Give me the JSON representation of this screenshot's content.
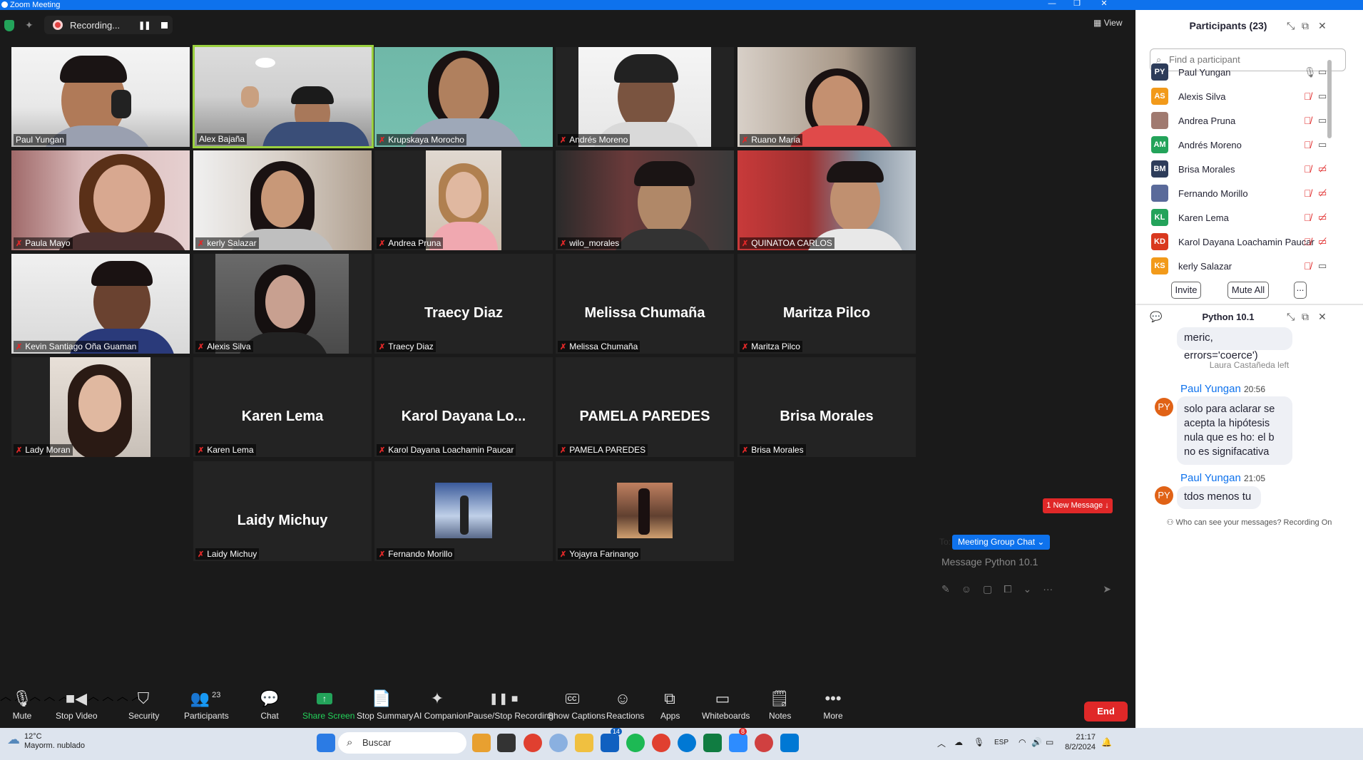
{
  "window": {
    "title": "Zoom Meeting"
  },
  "recording": {
    "label": "Recording..."
  },
  "view": {
    "label": "View"
  },
  "tiles": [
    {
      "name": "Paul Yungan"
    },
    {
      "name": "Alex Bajaña"
    },
    {
      "name": "Krupskaya Morocho"
    },
    {
      "name": "Andrés Moreno"
    },
    {
      "name": "Ruano Maria"
    },
    {
      "name": "Paula Mayo"
    },
    {
      "name": "kerly Salazar"
    },
    {
      "name": "Andrea Pruna"
    },
    {
      "name": "wilo_morales"
    },
    {
      "name": "QUINATOA CARLOS"
    },
    {
      "name": "Kevin Santiago Oña Guaman"
    },
    {
      "name": "Alexis Silva"
    },
    {
      "name": "Traecy Diaz",
      "big": "Traecy Diaz"
    },
    {
      "name": "Melissa Chumaña",
      "big": "Melissa Chumaña"
    },
    {
      "name": "Maritza Pilco",
      "big": "Maritza Pilco"
    },
    {
      "name": "Lady Moran"
    },
    {
      "name": "Karen Lema",
      "big": "Karen Lema"
    },
    {
      "name": "Karol Dayana Loachamin Paucar",
      "big": "Karol  Dayana  Lo..."
    },
    {
      "name": "PAMELA PAREDES",
      "big": "PAMELA PAREDES"
    },
    {
      "name": "Brisa Morales",
      "big": "Brisa Morales"
    },
    {
      "name": "Laidy Michuy",
      "big": "Laidy Michuy"
    },
    {
      "name": "Fernando Morillo"
    },
    {
      "name": "Yojayra Farinango"
    }
  ],
  "toolbar": {
    "mute": "Mute",
    "stop_video": "Stop Video",
    "security": "Security",
    "participants": "Participants",
    "participants_count": "23",
    "chat": "Chat",
    "share_screen": "Share Screen",
    "stop_summary": "Stop Summary",
    "ai_companion": "AI Companion",
    "pause_stop_recording": "Pause/Stop Recording",
    "show_captions": "Show Captions",
    "reactions": "Reactions",
    "apps": "Apps",
    "whiteboards": "Whiteboards",
    "notes": "Notes",
    "more": "More",
    "end": "End",
    "cc": "CC"
  },
  "participants_panel": {
    "title": "Participants (23)",
    "search_placeholder": "Find a participant",
    "list": [
      {
        "initials": "PY",
        "name": "Paul Yungan",
        "color": "#2d3c5a"
      },
      {
        "initials": "AS",
        "name": "Alexis Silva",
        "color": "#f29a1a"
      },
      {
        "initials": "",
        "name": "Andrea Pruna",
        "color": "#a07a70"
      },
      {
        "initials": "AM",
        "name": "Andrés Moreno",
        "color": "#23a35a"
      },
      {
        "initials": "BM",
        "name": "Brisa Morales",
        "color": "#2d3c5a"
      },
      {
        "initials": "",
        "name": "Fernando Morillo",
        "color": "#5a6a9a"
      },
      {
        "initials": "KL",
        "name": "Karen Lema",
        "color": "#23a35a"
      },
      {
        "initials": "KD",
        "name": "Karol Dayana Loachamin Paucar",
        "color": "#d9381e"
      },
      {
        "initials": "KS",
        "name": "kerly Salazar",
        "color": "#f29a1a"
      }
    ],
    "invite": "Invite",
    "mute_all": "Mute All",
    "more": "..."
  },
  "chat": {
    "title": "Python 10.1",
    "partial_message": "meric, errors='coerce')",
    "system": "Laura Castañeda left",
    "messages": [
      {
        "sender": "Paul Yungan",
        "time": "20:56",
        "initials": "PY",
        "text": "solo para aclarar se acepta la hipótesis nula que es ho: el b no es signifacativa"
      },
      {
        "sender": "Paul Yungan",
        "time": "21:05",
        "initials": "PY",
        "text": "tdos menos tu"
      }
    ],
    "new_message": "1 New Message",
    "who_can_see": "Who can see your messages? Recording On",
    "to_label": "To:",
    "to_value": "Meeting Group Chat",
    "input_placeholder": "Message Python 10.1"
  },
  "taskbar": {
    "weather_temp": "12°C",
    "weather_desc": "Mayorm. nublado",
    "search": "Buscar",
    "lang": "ESP",
    "time": "21:17",
    "date": "8/2/2024",
    "badge_outlook": "14",
    "badge_zoom": "8"
  }
}
